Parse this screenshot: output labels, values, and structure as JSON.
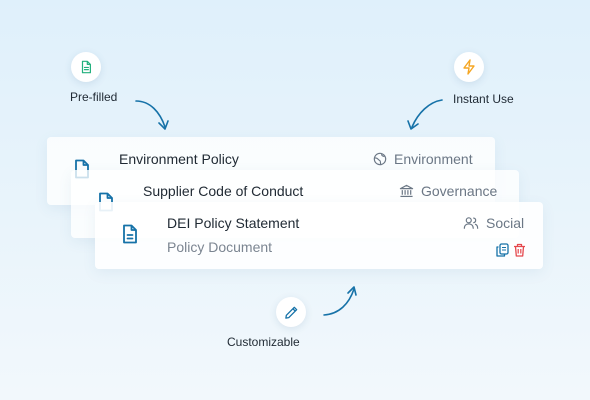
{
  "callouts": {
    "prefilled": "Pre-filled",
    "instant": "Instant Use",
    "customizable": "Customizable"
  },
  "cards": [
    {
      "title": "Environment Policy",
      "category": "Environment",
      "category_icon": "globe-icon"
    },
    {
      "title": "Supplier Code of Conduct",
      "category": "Governance",
      "category_icon": "bank-icon"
    },
    {
      "title": "DEI Policy Statement",
      "subtitle": "Policy Document",
      "category": "Social",
      "category_icon": "users-icon",
      "actions": [
        "copy-icon",
        "delete-icon"
      ]
    }
  ],
  "colors": {
    "prefilled_icon": "#22b07d",
    "instant_icon": "#f5a623",
    "customizable_icon": "#1672a8",
    "document_icon": "#1672a8",
    "arrow": "#1672a8",
    "delete_icon": "#e5484d"
  }
}
